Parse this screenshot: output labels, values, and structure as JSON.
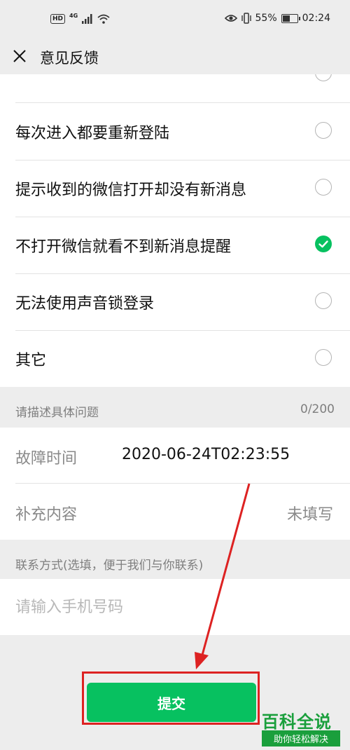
{
  "status_bar": {
    "hd": "HD",
    "network": "4G",
    "battery_pct_text": "55%",
    "battery_level": 0.55,
    "time": "02:24"
  },
  "header": {
    "title": "意见反馈",
    "close_icon": "close-icon"
  },
  "options": [
    {
      "label": "每次进入都要重新登陆",
      "checked": false
    },
    {
      "label": "提示收到的微信打开却没有新消息",
      "checked": false
    },
    {
      "label": "不打开微信就看不到新消息提醒",
      "checked": true
    },
    {
      "label": "无法使用声音锁登录",
      "checked": false
    },
    {
      "label": "其它",
      "checked": false
    }
  ],
  "describe": {
    "label": "请描述具体问题",
    "count": "0/200"
  },
  "fault_time": {
    "label": "故障时间",
    "value": "2020-06-24T02:23:55"
  },
  "supplement": {
    "label": "补充内容",
    "value": "未填写"
  },
  "contact": {
    "label": "联系方式(选填，便于我们与你联系)",
    "placeholder": "请输入手机号码"
  },
  "submit": {
    "label": "提交"
  },
  "watermark": {
    "title": "百科全说",
    "subtitle": "助你轻松解决"
  },
  "colors": {
    "accent": "#07c160",
    "annotation": "#dd2222",
    "watermark": "#1a9f3c"
  }
}
